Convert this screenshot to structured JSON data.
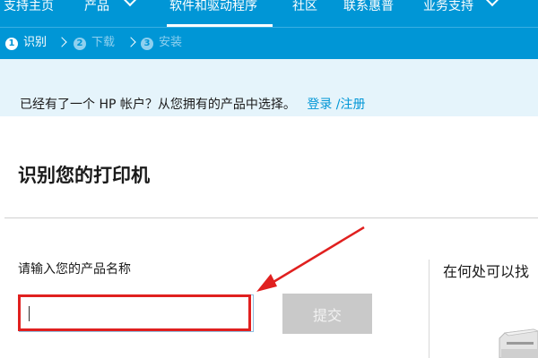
{
  "nav": {
    "items": [
      {
        "label": "支持主页"
      },
      {
        "label": "产品"
      },
      {
        "label": "软件和驱动程序"
      },
      {
        "label": "社区"
      },
      {
        "label": "联系惠普"
      },
      {
        "label": "业务支持"
      }
    ],
    "active_index": 2
  },
  "steps": [
    {
      "num": "1",
      "label": "识别",
      "state": "current"
    },
    {
      "num": "2",
      "label": "下载",
      "state": "upcoming"
    },
    {
      "num": "3",
      "label": "安装",
      "state": "upcoming"
    }
  ],
  "signin": {
    "text": "已经有了一个 HP 帐户？从您拥有的产品中选择。",
    "login_label": "登录",
    "separator": "/",
    "register_label": "注册"
  },
  "main": {
    "title": "识别您的打印机",
    "input_label": "请输入您的产品名称",
    "input_value": "",
    "submit_label": "提交",
    "right_heading": "在何处可以找"
  },
  "colors": {
    "brand_blue": "#0096d6",
    "annotation_red": "#e0201f",
    "disabled_button": "#c9c9c9"
  },
  "icons": {
    "dropdown": "chevron-down-icon",
    "step_separator": "chevron-right-icon"
  }
}
